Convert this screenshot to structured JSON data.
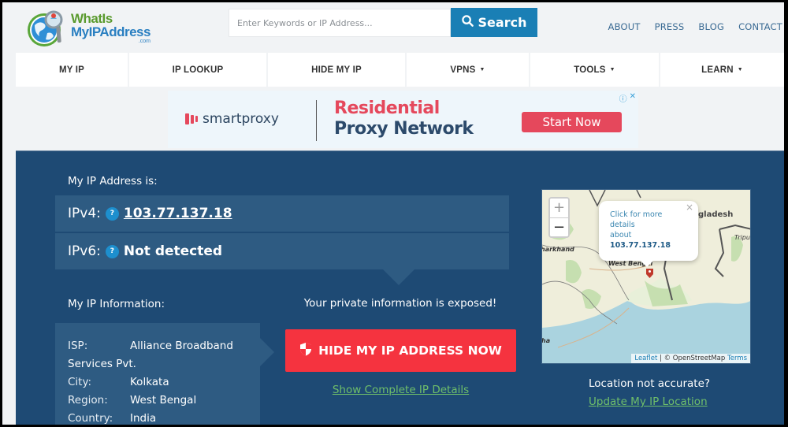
{
  "header": {
    "logo": {
      "line1": "WhatIs",
      "line2": "MyIPAddress",
      "suffix": ".com"
    },
    "search": {
      "placeholder": "Enter Keywords or IP Address...",
      "value": "",
      "button_label": "Search",
      "icon": "search-icon"
    },
    "top_links": [
      "ABOUT",
      "PRESS",
      "BLOG",
      "CONTACT"
    ]
  },
  "nav": {
    "items": [
      {
        "label": "MY IP",
        "dropdown": false
      },
      {
        "label": "IP LOOKUP",
        "dropdown": false
      },
      {
        "label": "HIDE MY IP",
        "dropdown": false
      },
      {
        "label": "VPNS",
        "dropdown": true
      },
      {
        "label": "TOOLS",
        "dropdown": true
      },
      {
        "label": "LEARN",
        "dropdown": true
      }
    ],
    "caret": "▼"
  },
  "ad": {
    "brand": "smartproxy",
    "headline1": "Residential",
    "headline2": "Proxy Network",
    "cta": "Start Now",
    "info_icon": "ⓘ",
    "close_icon": "✕",
    "colors": {
      "accent": "#e5485c",
      "dark": "#2c4a6b"
    }
  },
  "main": {
    "ip_heading": "My IP Address is:",
    "ipv4": {
      "label": "IPv4:",
      "help": "?",
      "value": "103.77.137.18"
    },
    "ipv6": {
      "label": "IPv6:",
      "help": "?",
      "value": "Not detected"
    },
    "info_heading": "My IP Information:",
    "info": [
      {
        "key": "ISP:",
        "value": "Alliance Broadband Services Pvt."
      },
      {
        "key": "City:",
        "value": "Kolkata"
      },
      {
        "key": "Region:",
        "value": "West Bengal"
      },
      {
        "key": "Country:",
        "value": "India"
      }
    ],
    "exposed_text": "Your private information is exposed!",
    "hide_button": "HIDE MY IP ADDRESS NOW",
    "show_details_link": "Show Complete IP Details",
    "colors": {
      "panel": "#1e4a74",
      "row": "#2e5b82",
      "danger": "#f5333f",
      "link": "#6fbf6a"
    }
  },
  "map": {
    "zoom_in": "+",
    "zoom_out": "−",
    "popup": {
      "line1": "Click for more",
      "line2": "details",
      "line3": "about",
      "ip": "103.77.137.18",
      "close": "×"
    },
    "labels": {
      "bangladesh": "gladesh",
      "jharkhand": "harkhand",
      "west_bengal": "West Bengal",
      "tripura": "Tripu",
      "odisha": "ha"
    },
    "attribution": {
      "leaflet": "Leaflet",
      "sep": " | © ",
      "osm": "OpenStreetMap",
      "terms": "Terms"
    }
  },
  "location": {
    "question": "Location not accurate?",
    "update_link": "Update My IP Location"
  }
}
